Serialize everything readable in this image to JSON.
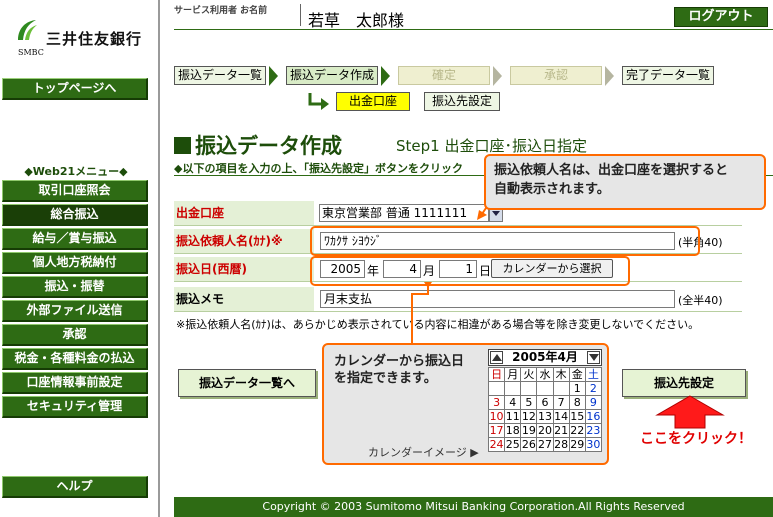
{
  "brand": {
    "name": "三井住友銀行",
    "sub": "SMBC"
  },
  "sidebar": {
    "top_button": "トップページへ",
    "menu_title": "◆Web21メニュー◆",
    "items": [
      {
        "label": "取引口座照会"
      },
      {
        "label": "総合振込"
      },
      {
        "label": "給与／賞与振込"
      },
      {
        "label": "個人地方税納付"
      },
      {
        "label": "振込・振替"
      },
      {
        "label": "外部ファイル送信"
      },
      {
        "label": "承認"
      },
      {
        "label": "税金・各種料金の払込"
      },
      {
        "label": "口座情報事前設定"
      },
      {
        "label": "セキュリティ管理"
      }
    ],
    "help_button": "ヘルプ"
  },
  "header": {
    "user_label": "サービス利用者 お名前",
    "user_name": "若草　太郎様",
    "logout": "ログアウト"
  },
  "steps": {
    "items": [
      {
        "label": "振込データ一覧"
      },
      {
        "label": "振込データ作成"
      },
      {
        "label": "確定"
      },
      {
        "label": "承認"
      },
      {
        "label": "完了データ一覧"
      }
    ],
    "sub_current": "出金口座",
    "sub_other": "振込先設定"
  },
  "page": {
    "title": "振込データ作成",
    "step": "Step1  出金口座･振込日指定",
    "instruction": "◆以下の項目を入力の上、「振込先設定」ボタンをクリック"
  },
  "form": {
    "account_label": "出金口座",
    "account_value": "東京営業部 普通 1111111",
    "name_label": "振込依頼人名(ｶﾅ)※",
    "name_value": "ﾜｶｸｻ ｼﾖｳｼﾞ",
    "name_hint": "(半角40)",
    "date_label": "振込日(西暦)",
    "year": "2005",
    "year_unit": "年",
    "month": "4",
    "month_unit": "月",
    "day": "1",
    "day_unit": "日",
    "calendar_button": "カレンダーから選択",
    "memo_label": "振込メモ",
    "memo_value": "月末支払",
    "memo_hint": "(全半40)",
    "note": "※振込依頼人名(ｶﾅ)は、あらかじめ表示されている内容に相違がある場合等を除き変更しないでください。"
  },
  "callouts": {
    "top_line1": "振込依頼人名は、出金口座を選択すると",
    "top_line2": "自動表示されます。",
    "cal_line1": "カレンダーから振込日",
    "cal_line2": "を指定できます。",
    "cal_caption": "カレンダーイメージ ▶"
  },
  "calendar": {
    "month": "2005年4月",
    "weekdays": [
      "日",
      "月",
      "火",
      "水",
      "木",
      "金",
      "土"
    ],
    "weeks": [
      [
        "",
        "",
        "",
        "",
        "",
        "1",
        "2"
      ],
      [
        "3",
        "4",
        "5",
        "6",
        "7",
        "8",
        "9"
      ],
      [
        "10",
        "11",
        "12",
        "13",
        "14",
        "15",
        "16"
      ],
      [
        "17",
        "18",
        "19",
        "20",
        "21",
        "22",
        "23"
      ],
      [
        "24",
        "25",
        "26",
        "27",
        "28",
        "29",
        "30"
      ]
    ]
  },
  "buttons": {
    "list": "振込データ一覧へ",
    "dest": "振込先設定",
    "click_here": "ここをクリック！"
  },
  "footer": "Copyright © 2003 Sumitomo Mitsui Banking Corporation.All Rights Reserved",
  "colors": {
    "brand_green": "#2e6b14",
    "accent_orange": "#ff6a00",
    "highlight_yellow": "#ffff00",
    "alert_red": "#e00000"
  }
}
